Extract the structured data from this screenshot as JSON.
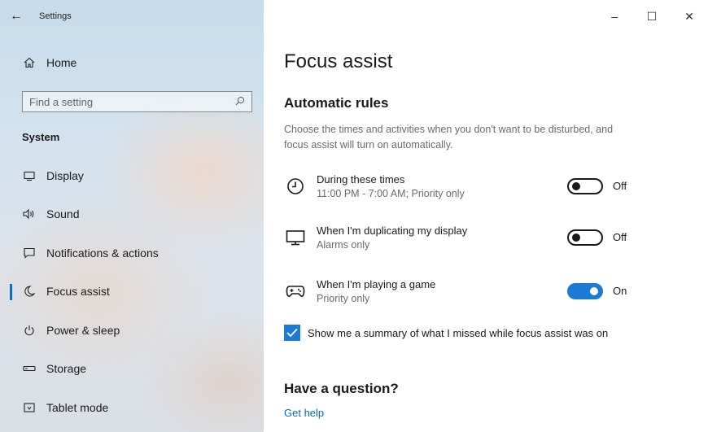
{
  "window": {
    "title": "Settings",
    "controls": {
      "minimize": "–",
      "maximize": "☐",
      "close": "✕"
    }
  },
  "sidebar": {
    "back_icon": "back-arrow-icon",
    "home": {
      "label": "Home",
      "icon": "home-icon"
    },
    "search": {
      "placeholder": "Find a setting",
      "icon": "search-icon"
    },
    "section": "System",
    "items": [
      {
        "label": "Display",
        "icon": "display-icon",
        "active": false
      },
      {
        "label": "Sound",
        "icon": "sound-icon",
        "active": false
      },
      {
        "label": "Notifications & actions",
        "icon": "notifications-icon",
        "active": false
      },
      {
        "label": "Focus assist",
        "icon": "moon-icon",
        "active": true
      },
      {
        "label": "Power & sleep",
        "icon": "power-icon",
        "active": false
      },
      {
        "label": "Storage",
        "icon": "storage-icon",
        "active": false
      },
      {
        "label": "Tablet mode",
        "icon": "tablet-icon",
        "active": false
      }
    ]
  },
  "main": {
    "title": "Focus assist",
    "subtitle": "Automatic rules",
    "description": "Choose the times and activities when you don't want to be disturbed, and focus assist will turn on automatically.",
    "rules": [
      {
        "name": "During these times",
        "detail": "11:00 PM - 7:00 AM; Priority only",
        "icon": "clock-icon",
        "state": "Off",
        "on": false
      },
      {
        "name": "When I'm duplicating my display",
        "detail": "Alarms only",
        "icon": "monitor-icon",
        "state": "Off",
        "on": false
      },
      {
        "name": "When I'm playing a game",
        "detail": "Priority only",
        "icon": "gamepad-icon",
        "state": "On",
        "on": true
      }
    ],
    "summary_checkbox": {
      "label": "Show me a summary of what I missed while focus assist was on",
      "checked": true
    },
    "question_title": "Have a question?",
    "help_link": "Get help"
  },
  "colors": {
    "accent": "#1a7ad4",
    "link": "#0a66c2",
    "muted_text": "#6b6b6b"
  }
}
